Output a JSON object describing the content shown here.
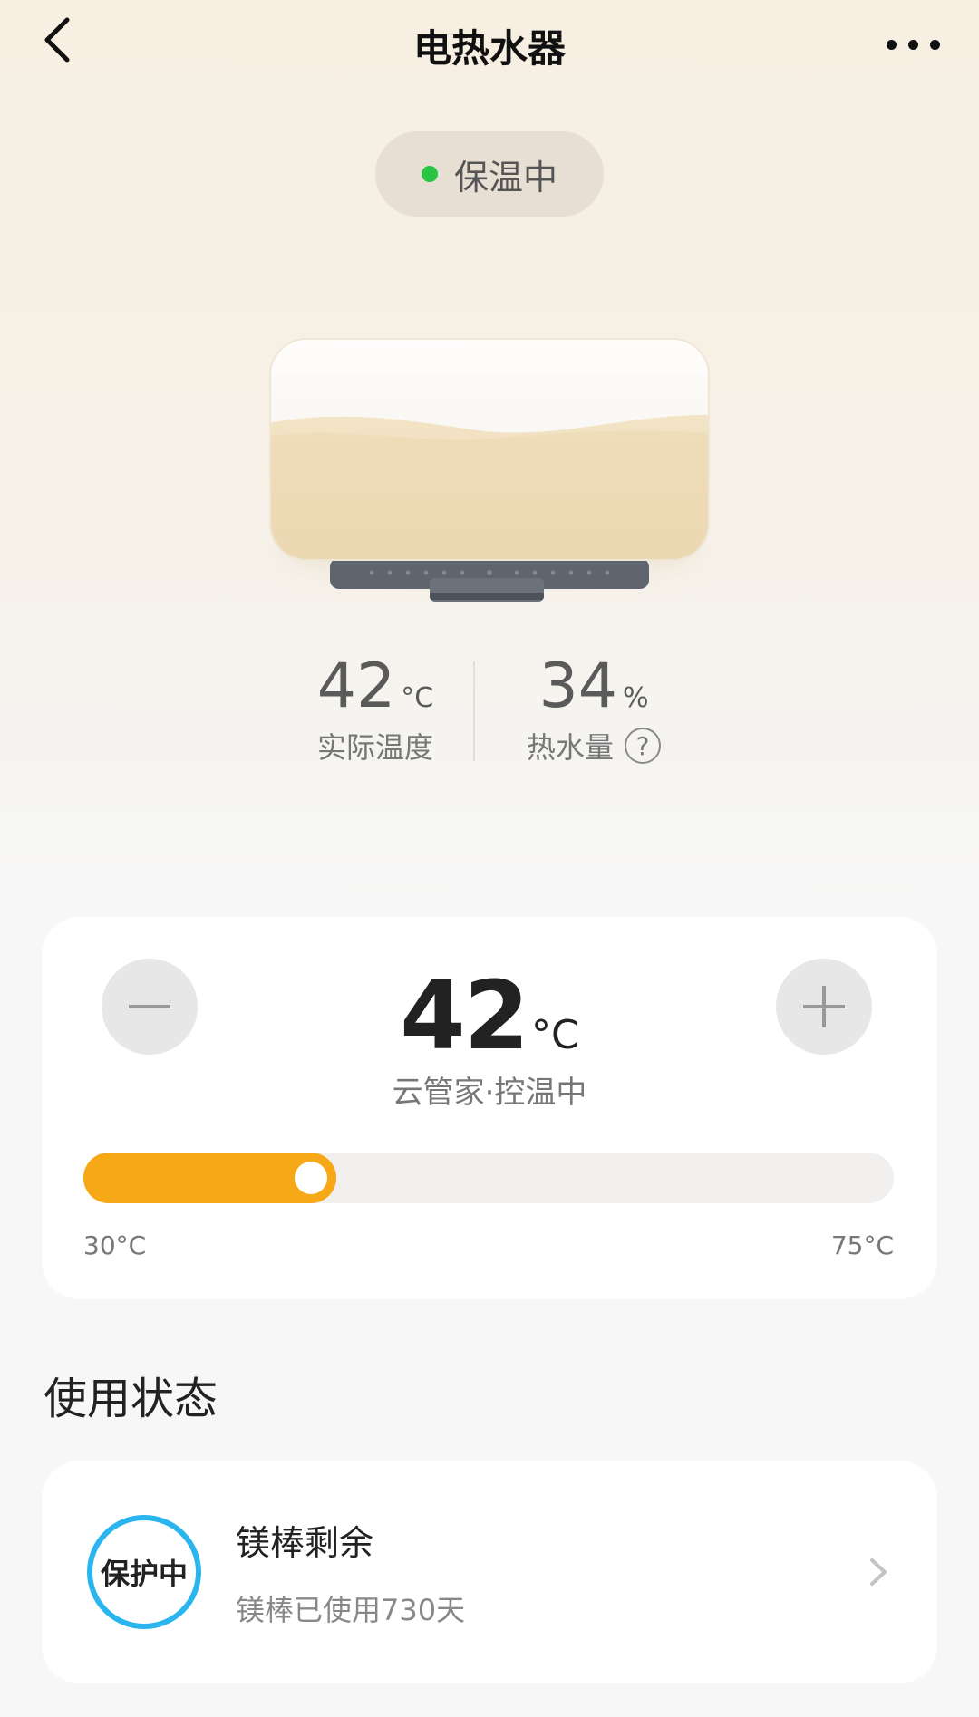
{
  "header": {
    "title": "电热水器"
  },
  "status": {
    "label": "保温中",
    "dot_color": "#29c441"
  },
  "stats": {
    "actual_temp": {
      "value": "42",
      "unit": "°C",
      "label": "实际温度"
    },
    "hot_water": {
      "value": "34",
      "unit": "%",
      "label": "热水量",
      "help": "?"
    }
  },
  "temp_control": {
    "set_value": "42",
    "unit": "°C",
    "mode": "云管家·控温中",
    "min_label": "30°C",
    "max_label": "75°C",
    "slider": {
      "min": 30,
      "max": 75,
      "value": 42
    },
    "accent_color": "#f7a816"
  },
  "usage": {
    "section_title": "使用状态",
    "rod": {
      "badge": "保护中",
      "title": "镁棒剩余",
      "subtitle": "镁棒已使用730天",
      "ring_color": "#2ab5ef"
    }
  }
}
